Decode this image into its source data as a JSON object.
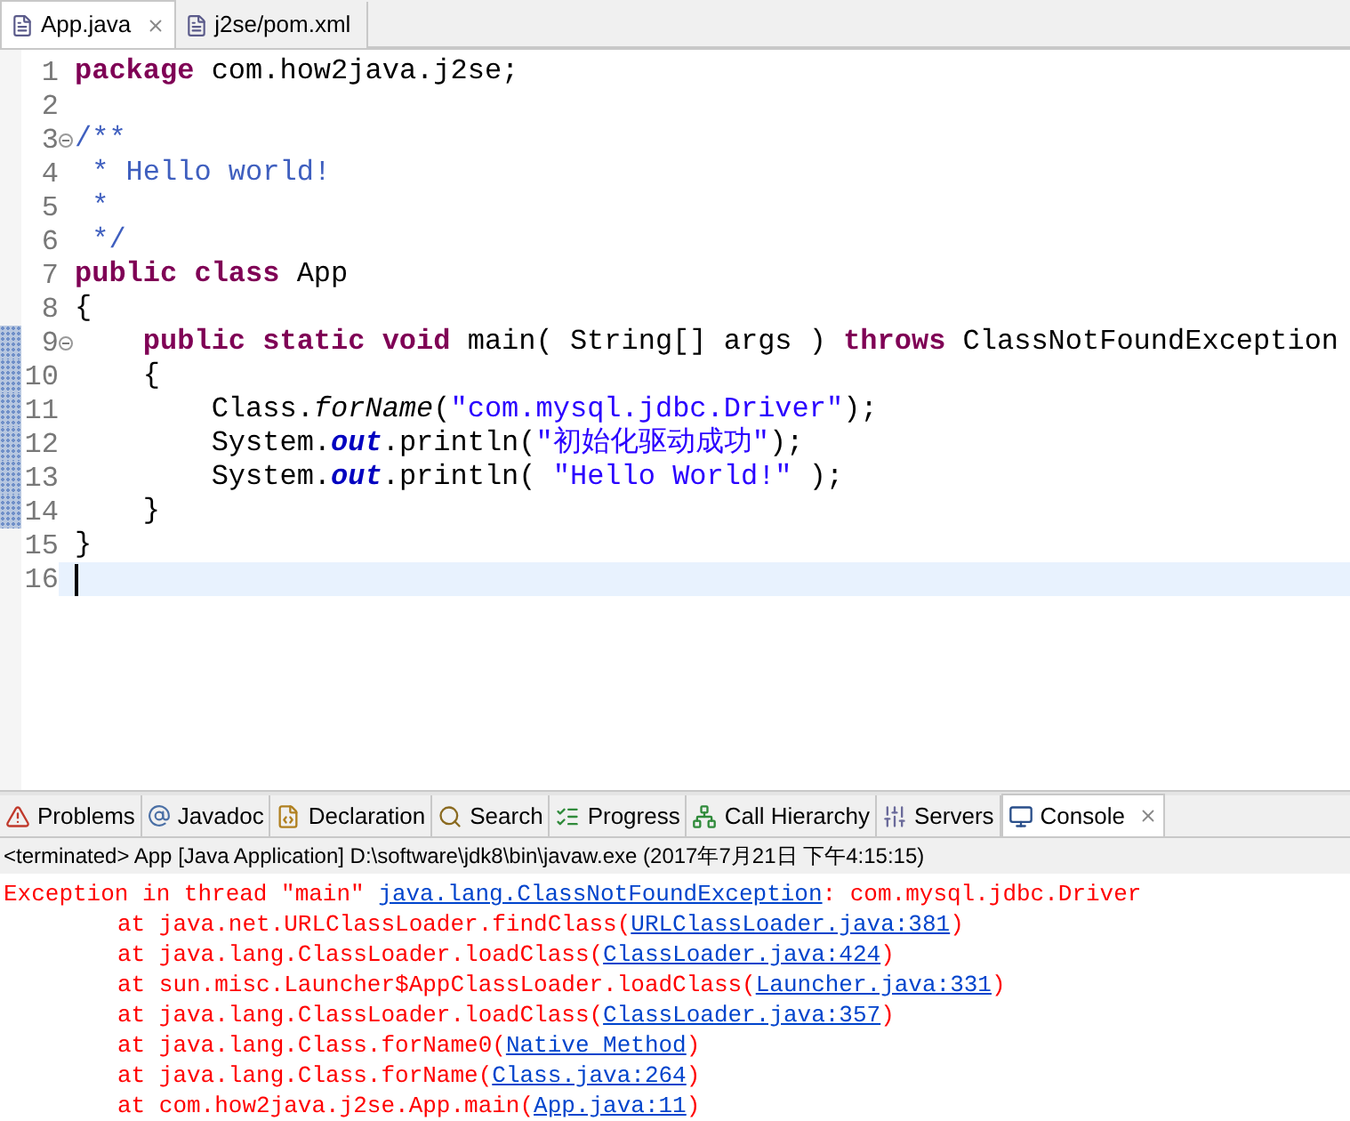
{
  "editor_tabs": [
    {
      "label": "App.java",
      "selected": true
    },
    {
      "label": "j2se/pom.xml",
      "selected": false
    }
  ],
  "code_lines": [
    {
      "number": "1",
      "foldable": false,
      "changed": false,
      "current": false,
      "segments": [
        {
          "text": "package",
          "kind": "keyword"
        },
        {
          "text": " com.how2java.j2se;",
          "kind": "plain"
        }
      ]
    },
    {
      "number": "2",
      "foldable": false,
      "changed": false,
      "current": false
    },
    {
      "number": "3",
      "foldable": true,
      "changed": false,
      "current": false,
      "segments": [
        {
          "text": "/**",
          "kind": "comment"
        }
      ]
    },
    {
      "number": "4",
      "foldable": false,
      "changed": false,
      "current": false,
      "segments": [
        {
          "text": " * Hello world!",
          "kind": "comment"
        }
      ]
    },
    {
      "number": "5",
      "foldable": false,
      "changed": false,
      "current": false,
      "segments": [
        {
          "text": " *",
          "kind": "comment"
        }
      ]
    },
    {
      "number": "6",
      "foldable": false,
      "changed": false,
      "current": false,
      "segments": [
        {
          "text": " */",
          "kind": "comment"
        }
      ]
    },
    {
      "number": "7",
      "foldable": false,
      "changed": false,
      "current": false,
      "segments": [
        {
          "text": "public class",
          "kind": "keyword"
        },
        {
          "text": " App",
          "kind": "plain"
        }
      ]
    },
    {
      "number": "8",
      "foldable": false,
      "changed": false,
      "current": false,
      "segments": [
        {
          "text": "{",
          "kind": "plain"
        }
      ]
    },
    {
      "number": "9",
      "foldable": true,
      "changed": true,
      "current": false,
      "segments": [
        {
          "text": "    public static void",
          "kind": "keyword"
        },
        {
          "text": " main( String[] args ) ",
          "kind": "plain"
        },
        {
          "text": "throws",
          "kind": "keyword"
        },
        {
          "text": " ClassNotFoundException",
          "kind": "plain"
        }
      ]
    },
    {
      "number": "10",
      "foldable": false,
      "changed": true,
      "current": false,
      "segments": [
        {
          "text": "    {",
          "kind": "plain"
        }
      ]
    },
    {
      "number": "11",
      "foldable": false,
      "changed": true,
      "current": false,
      "segments": [
        {
          "text": "        Class.",
          "kind": "plain"
        },
        {
          "text": "forName",
          "kind": "static_method"
        },
        {
          "text": "(",
          "kind": "plain"
        },
        {
          "text": "\"com.mysql.jdbc.Driver\"",
          "kind": "string"
        },
        {
          "text": ");",
          "kind": "plain"
        }
      ]
    },
    {
      "number": "12",
      "foldable": false,
      "changed": true,
      "current": false,
      "segments": [
        {
          "text": "        System.",
          "kind": "plain"
        },
        {
          "text": "out",
          "kind": "static_field"
        },
        {
          "text": ".println(",
          "kind": "plain"
        },
        {
          "text": "\"初始化驱动成功\"",
          "kind": "string"
        },
        {
          "text": ");",
          "kind": "plain"
        }
      ]
    },
    {
      "number": "13",
      "foldable": false,
      "changed": true,
      "current": false,
      "segments": [
        {
          "text": "        System.",
          "kind": "plain"
        },
        {
          "text": "out",
          "kind": "static_field"
        },
        {
          "text": ".println( ",
          "kind": "plain"
        },
        {
          "text": "\"Hello World!\"",
          "kind": "string"
        },
        {
          "text": " );",
          "kind": "plain"
        }
      ]
    },
    {
      "number": "14",
      "foldable": false,
      "changed": true,
      "current": false,
      "segments": [
        {
          "text": "    }",
          "kind": "plain"
        }
      ]
    },
    {
      "number": "15",
      "foldable": false,
      "changed": false,
      "current": false,
      "segments": [
        {
          "text": "}",
          "kind": "plain"
        }
      ]
    },
    {
      "number": "16",
      "foldable": false,
      "changed": false,
      "current": true
    }
  ],
  "panel_tabs": [
    {
      "label": "Problems",
      "selected": false
    },
    {
      "label": "Javadoc",
      "selected": false
    },
    {
      "label": "Declaration",
      "selected": false
    },
    {
      "label": "Search",
      "selected": false
    },
    {
      "label": "Progress",
      "selected": false
    },
    {
      "label": "Call Hierarchy",
      "selected": false
    },
    {
      "label": "Servers",
      "selected": false
    },
    {
      "label": "Console",
      "selected": true
    }
  ],
  "console": {
    "header": "<terminated> App [Java Application] D:\\software\\jdk8\\bin\\javaw.exe (2017年7月21日 下午4:15:15)",
    "lines": [
      {
        "indented": false,
        "segments": [
          {
            "text": "Exception in thread \"main\" ",
            "kind": "error"
          },
          {
            "text": "java.lang.ClassNotFoundException",
            "kind": "link"
          },
          {
            "text": ": com.mysql.jdbc.Driver",
            "kind": "error"
          }
        ]
      },
      {
        "indented": true,
        "segments": [
          {
            "text": "at java.net.URLClassLoader.findClass(",
            "kind": "error"
          },
          {
            "text": "URLClassLoader.java:381",
            "kind": "link"
          },
          {
            "text": ")",
            "kind": "error"
          }
        ]
      },
      {
        "indented": true,
        "segments": [
          {
            "text": "at java.lang.ClassLoader.loadClass(",
            "kind": "error"
          },
          {
            "text": "ClassLoader.java:424",
            "kind": "link"
          },
          {
            "text": ")",
            "kind": "error"
          }
        ]
      },
      {
        "indented": true,
        "segments": [
          {
            "text": "at sun.misc.Launcher$AppClassLoader.loadClass(",
            "kind": "error"
          },
          {
            "text": "Launcher.java:331",
            "kind": "link"
          },
          {
            "text": ")",
            "kind": "error"
          }
        ]
      },
      {
        "indented": true,
        "segments": [
          {
            "text": "at java.lang.ClassLoader.loadClass(",
            "kind": "error"
          },
          {
            "text": "ClassLoader.java:357",
            "kind": "link"
          },
          {
            "text": ")",
            "kind": "error"
          }
        ]
      },
      {
        "indented": true,
        "segments": [
          {
            "text": "at java.lang.Class.forName0(",
            "kind": "error"
          },
          {
            "text": "Native Method",
            "kind": "link"
          },
          {
            "text": ")",
            "kind": "error"
          }
        ]
      },
      {
        "indented": true,
        "segments": [
          {
            "text": "at java.lang.Class.forName(",
            "kind": "error"
          },
          {
            "text": "Class.java:264",
            "kind": "link"
          },
          {
            "text": ")",
            "kind": "error"
          }
        ]
      },
      {
        "indented": true,
        "segments": [
          {
            "text": "at com.how2java.j2se.App.main(",
            "kind": "error"
          },
          {
            "text": "App.java:11",
            "kind": "link"
          },
          {
            "text": ")",
            "kind": "error"
          }
        ]
      }
    ]
  }
}
